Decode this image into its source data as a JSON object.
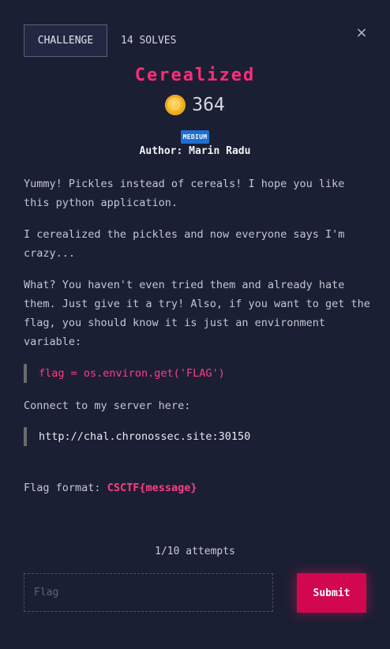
{
  "tabs": {
    "challenge_label": "CHALLENGE",
    "solves_label": "14 SOLVES"
  },
  "close_label": "×",
  "challenge": {
    "title": "Cerealized",
    "points": "364",
    "difficulty": "MEDIUM",
    "author": "Author: Marin Radu"
  },
  "description": {
    "paragraph1": "Yummy! Pickles instead of cereals! I hope you like this python application.",
    "paragraph2": "I cerealized the pickles and now everyone says I'm crazy...",
    "paragraph3": "What? You haven't even tried them and already hate them. Just give it a try! Also, if you want to get the flag, you should know it is just an environment variable:",
    "code1": "flag = os.environ.get('FLAG')",
    "paragraph4": "Connect to my server here:",
    "code2": "http://chal.chronossec.site:30150",
    "flag_format_label": "Flag format:",
    "flag_format_value": "CSCTF{message}"
  },
  "attempts": "1/10 attempts",
  "form": {
    "flag_placeholder": "Flag",
    "flag_value": "",
    "submit_label": "Submit"
  },
  "colors": {
    "background": "#1b1f33",
    "accent": "#ff2d78",
    "submit": "#d2084e",
    "badge": "#1f6fd1"
  },
  "icons": {
    "points": "coin-icon",
    "close": "close-icon"
  }
}
